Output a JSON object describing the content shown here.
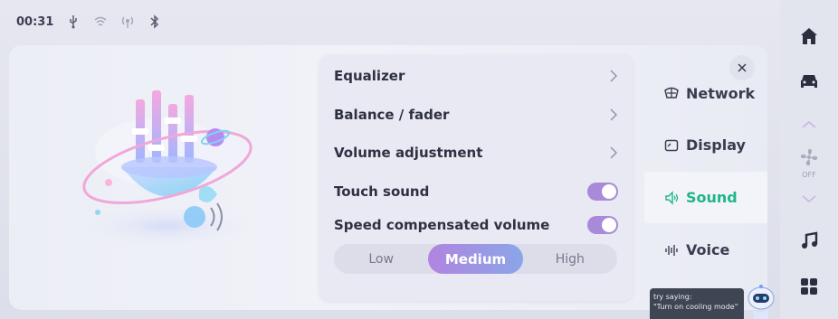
{
  "status_bar": {
    "time": "00:31",
    "icons": [
      "usb-icon",
      "wifi-icon",
      "hotspot-icon",
      "bluetooth-icon"
    ]
  },
  "settings": {
    "rows": [
      {
        "label": "Equalizer",
        "type": "link"
      },
      {
        "label": "Balance / fader",
        "type": "link"
      },
      {
        "label": "Volume adjustment",
        "type": "link"
      },
      {
        "label": "Touch sound",
        "type": "toggle",
        "on": true
      },
      {
        "label": "Speed compensated volume",
        "type": "toggle",
        "on": true
      }
    ],
    "speed_levels": [
      "Low",
      "Medium",
      "High"
    ],
    "selected_level": "Medium"
  },
  "categories": [
    {
      "label": "Network",
      "icon": "network-icon",
      "active": false
    },
    {
      "label": "Display",
      "icon": "display-icon",
      "active": false
    },
    {
      "label": "Sound",
      "icon": "speaker-icon",
      "active": true
    },
    {
      "label": "Voice",
      "icon": "voice-wave-icon",
      "active": false
    }
  ],
  "voice_hint": {
    "line1": "try saying:",
    "line2": "\"Turn on cooling mode\""
  },
  "dock": {
    "fan_state": "OFF",
    "items": [
      "home-icon",
      "car-icon",
      "chevron-up-icon",
      "fan-icon",
      "chevron-down-icon",
      "music-icon",
      "apps-grid-icon"
    ]
  },
  "colors": {
    "accent_active": "#1fb58a",
    "toggle_on": "#a88ad9",
    "segment_active_start": "#b184e0",
    "segment_active_end": "#8aa6e8"
  }
}
